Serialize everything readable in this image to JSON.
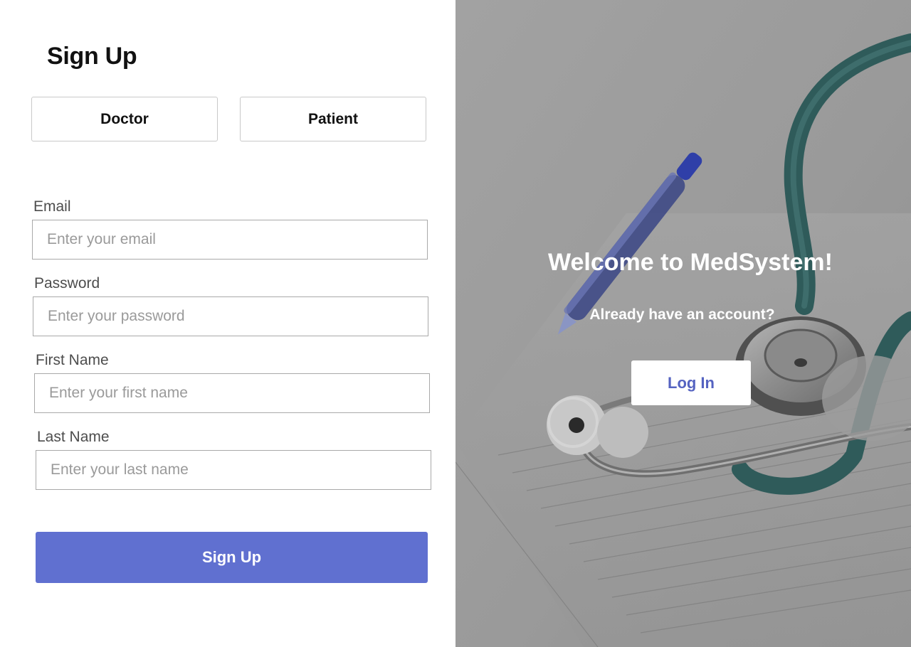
{
  "form": {
    "title": "Sign Up",
    "roles": {
      "doctor_label": "Doctor",
      "patient_label": "Patient"
    },
    "fields": {
      "email": {
        "label": "Email",
        "placeholder": "Enter your email",
        "value": ""
      },
      "password": {
        "label": "Password",
        "placeholder": "Enter your password",
        "value": ""
      },
      "first_name": {
        "label": "First Name",
        "placeholder": "Enter your first name",
        "value": ""
      },
      "last_name": {
        "label": "Last Name",
        "placeholder": "Enter your last name",
        "value": ""
      }
    },
    "submit_label": "Sign Up"
  },
  "hero": {
    "welcome": "Welcome to MedSystem!",
    "prompt": "Already have an account?",
    "login_label": "Log In",
    "image_subject": "stethoscope-and-pen-on-medical-chart"
  },
  "colors": {
    "accent": "#6070d0",
    "login_text": "#5563c1",
    "overlay": "#8a8a8a"
  }
}
